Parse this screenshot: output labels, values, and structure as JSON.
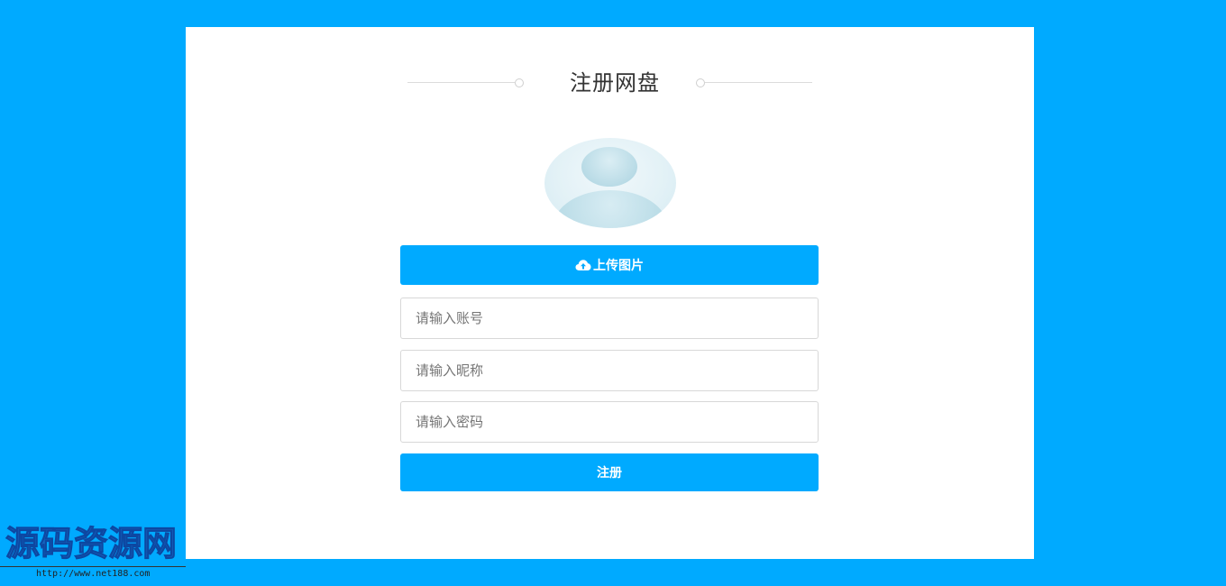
{
  "page": {
    "title": "注册网盘",
    "background_color": "#00aaff",
    "accent_color": "#00aaff"
  },
  "avatar": {
    "icon": "default-user-avatar-icon"
  },
  "upload_button": {
    "icon": "cloud-upload-icon",
    "label": "上传图片"
  },
  "form": {
    "account_placeholder": "请输入账号",
    "account_value": "",
    "nickname_placeholder": "请输入昵称",
    "nickname_value": "",
    "password_placeholder": "请输入密码",
    "password_value": ""
  },
  "submit_button": {
    "label": "注册"
  },
  "watermark": {
    "text": "源码资源网",
    "url": "http://www.net188.com"
  }
}
